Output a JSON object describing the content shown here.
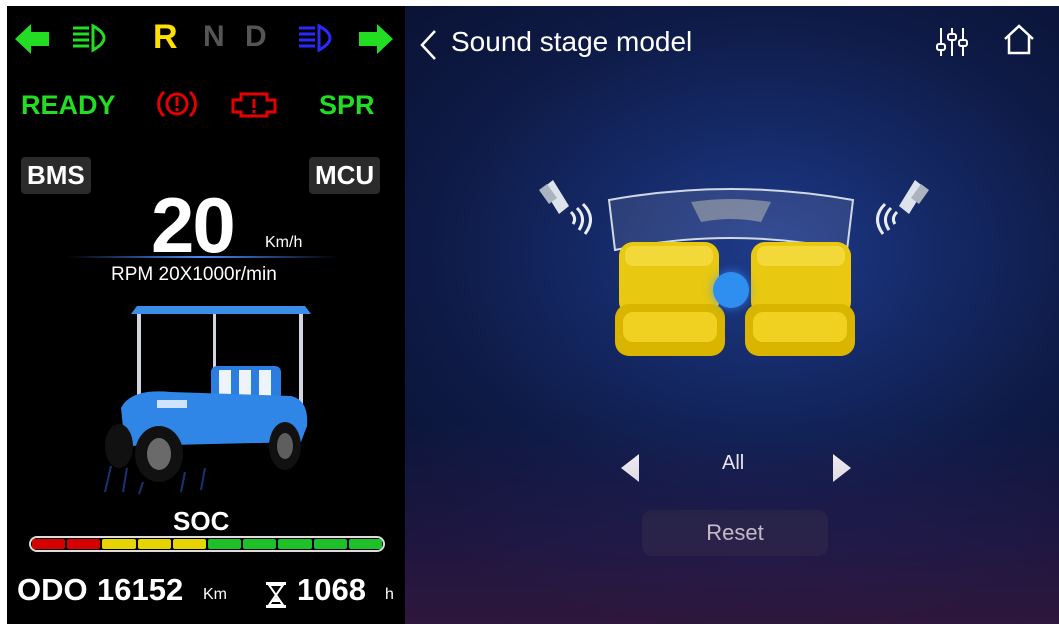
{
  "cluster": {
    "gears": [
      "R",
      "N",
      "D"
    ],
    "status": {
      "ready": "READY",
      "spr": "SPR"
    },
    "bms_label": "BMS",
    "mcu_label": "MCU",
    "speed": "20",
    "speed_unit": "Km/h",
    "rpm_text": "RPM 20X1000r/min",
    "soc_label": "SOC",
    "soc_segments": [
      "#d50000",
      "#d50000",
      "#e6d400",
      "#e6d400",
      "#e6d400",
      "#1fbf2a",
      "#1fbf2a",
      "#1fbf2a",
      "#1fbf2a",
      "#1fbf2a"
    ],
    "odo_label": "ODO",
    "odo_value": "16152",
    "odo_unit": "Km",
    "hours_value": "1068",
    "hours_unit": "h",
    "icons": [
      "left-turn-arrow-icon",
      "low-beam-icon",
      "high-beam-icon",
      "right-turn-arrow-icon",
      "parking-brake-icon",
      "motor-fault-icon",
      "hourglass-icon"
    ],
    "colors": {
      "green": "#22dd22",
      "yellow": "#ffe000",
      "gray": "#555555",
      "blue": "#2a2aff",
      "red": "#e60000"
    }
  },
  "sound": {
    "back_icon": "chevron-left-icon",
    "title": "Sound stage model",
    "equalizer_icon": "equalizer-icon",
    "home_icon": "home-icon",
    "mode": "All",
    "reset_label": "Reset",
    "icons": [
      "left-speaker-icon",
      "right-speaker-icon",
      "prev-arrow-icon",
      "next-arrow-icon",
      "seat-icon",
      "focus-dot-icon"
    ]
  }
}
